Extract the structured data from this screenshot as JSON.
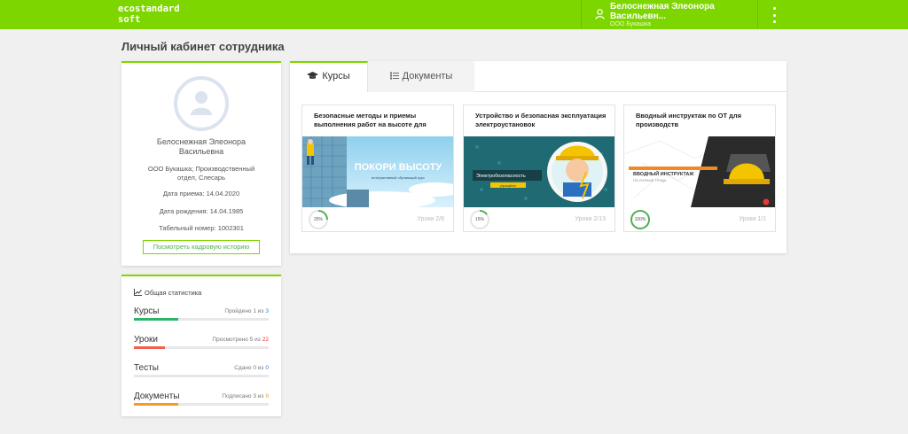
{
  "header": {
    "logo_line1": "ecostandard",
    "logo_line2": "soft",
    "user_name": "Белоснежная Элеонора Васильевн...",
    "user_org": "ООО Букашка",
    "menu_icon": "more-vertical-icon"
  },
  "page_title": "Личный кабинет сотрудника",
  "profile": {
    "name": "Белоснежная Элеонора Васильевна",
    "department": "ООО Букашка; Производственный отдел, Слесарь",
    "hire_date": "Дата приема: 14.04.2020",
    "birth_date": "Дата рождения: 14.04.1985",
    "tab_number": "Табельный номер: 1002301",
    "history_button": "Посмотреть кадровую историю"
  },
  "stats": {
    "title": "Общая статистика",
    "rows": [
      {
        "name": "Курсы",
        "status": "Пройдено 1 из",
        "total": "3",
        "fraction": 0.33,
        "color": "#2db36a",
        "total_color": "#2f7fd1"
      },
      {
        "name": "Уроки",
        "status": "Просмотрено 5 из",
        "total": "22",
        "fraction": 0.23,
        "color": "#f0614d",
        "total_color": "#e53935"
      },
      {
        "name": "Тесты",
        "status": "Сдано 0 из",
        "total": "0",
        "fraction": 0,
        "color": "#2f7fd1",
        "total_color": "#2f7fd1"
      },
      {
        "name": "Документы",
        "status": "Подписано 3 из",
        "total": "9",
        "fraction": 0.33,
        "color": "#f39c24",
        "total_color": "#f39c24"
      }
    ]
  },
  "tabs": {
    "courses": "Курсы",
    "documents": "Документы"
  },
  "courses": [
    {
      "title": "Безопасные методы и приемы выполнения работ на высоте для",
      "banner": "ПОКОРИ ВЫСОТУ",
      "banner_sub": "интерактивный обучающий курс",
      "progress_label": "25%",
      "progress": 0.25,
      "lessons": "Уроки 2/8"
    },
    {
      "title": "Устройство и безопасная эксплуатация электроустановок",
      "banner": "Электробезопасность",
      "banner_sub": "упрощённо",
      "progress_label": "15%",
      "progress": 0.15,
      "lessons": "Уроки 2/13"
    },
    {
      "title": "Вводный инструктаж по ОТ для производств",
      "banner": "ВВОДНЫЙ ИНСТРУКТАЖ",
      "banner_sub": "ПО ОХРАНЕ ТРУДА",
      "progress_label": "100%",
      "progress": 1.0,
      "lessons": "Уроки 1/1"
    }
  ],
  "colors": {
    "brand": "#7ed600",
    "progress": "#4caf50"
  }
}
